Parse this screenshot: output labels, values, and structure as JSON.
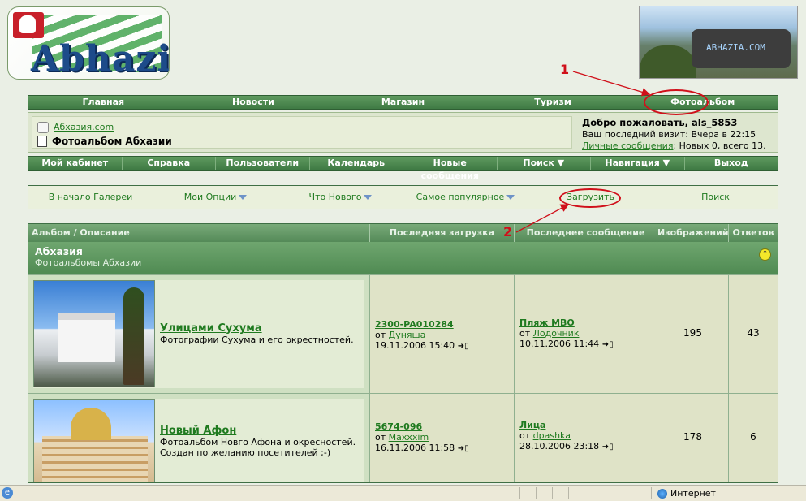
{
  "logo": {
    "text": "Abhazia"
  },
  "header_photo": {
    "text": "ABHAZIA.COM"
  },
  "annotations": {
    "one": "1",
    "two": "2"
  },
  "topnav": [
    "Главная",
    "Новости",
    "Магазин",
    "Туризм",
    "Фотоальбом"
  ],
  "breadcrumb": {
    "site": "Абхазия.com",
    "title": "Фотоальбом Абхазии"
  },
  "welcome": {
    "greeting": "Добро пожаловать, als_5853",
    "last_visit": "Ваш последний визит: Вчера в 22:15",
    "pm_link": "Личные сообщения",
    "pm_text": ": Новых 0, всего 13."
  },
  "usernav": [
    "Мой кабинет",
    "Справка",
    "Пользователи",
    "Календарь",
    "Новые сообщения",
    "Поиск",
    "Навигация",
    "Выход"
  ],
  "gallery_nav": [
    "В начало Галереи",
    "Мои Опции",
    "Что Нового",
    "Самое популярное",
    "Загрузить",
    "Поиск"
  ],
  "table": {
    "headers": [
      "Альбом / Описание",
      "Последняя загрузка",
      "Последнее сообщение",
      "Изображений",
      "Ответов"
    ],
    "category": {
      "name": "Абхазия",
      "description": "Фотоальбомы Абхазии"
    },
    "albums": [
      {
        "name": "Улицами Сухума",
        "description": "Фотографии Сухума и его окрестностей.",
        "upload_title": "2300-PA010284",
        "upload_by": "Дуняша",
        "upload_date": "19.11.2006 15:40",
        "post_title": "Пляж МВО",
        "post_by": "Лодочник",
        "post_date": "10.11.2006 11:44",
        "images": "195",
        "replies": "43"
      },
      {
        "name": "Новый Афон",
        "description": "Фотоальбом Новго Афона и окресностей. Создан по желанию посетителей ;-)",
        "upload_title": "5674-096",
        "upload_by": "Maxxxim",
        "upload_date": "16.11.2006 11:58",
        "post_title": "Лица",
        "post_by": "dpashka",
        "post_date": "28.10.2006 23:18",
        "images": "178",
        "replies": "6"
      }
    ],
    "from_label": "от"
  },
  "statusbar": {
    "zone": "Интернет"
  },
  "colors": {
    "accent_green": "#3f7a44",
    "annotation_red": "#d0101a",
    "link": "#1f7a1f"
  }
}
